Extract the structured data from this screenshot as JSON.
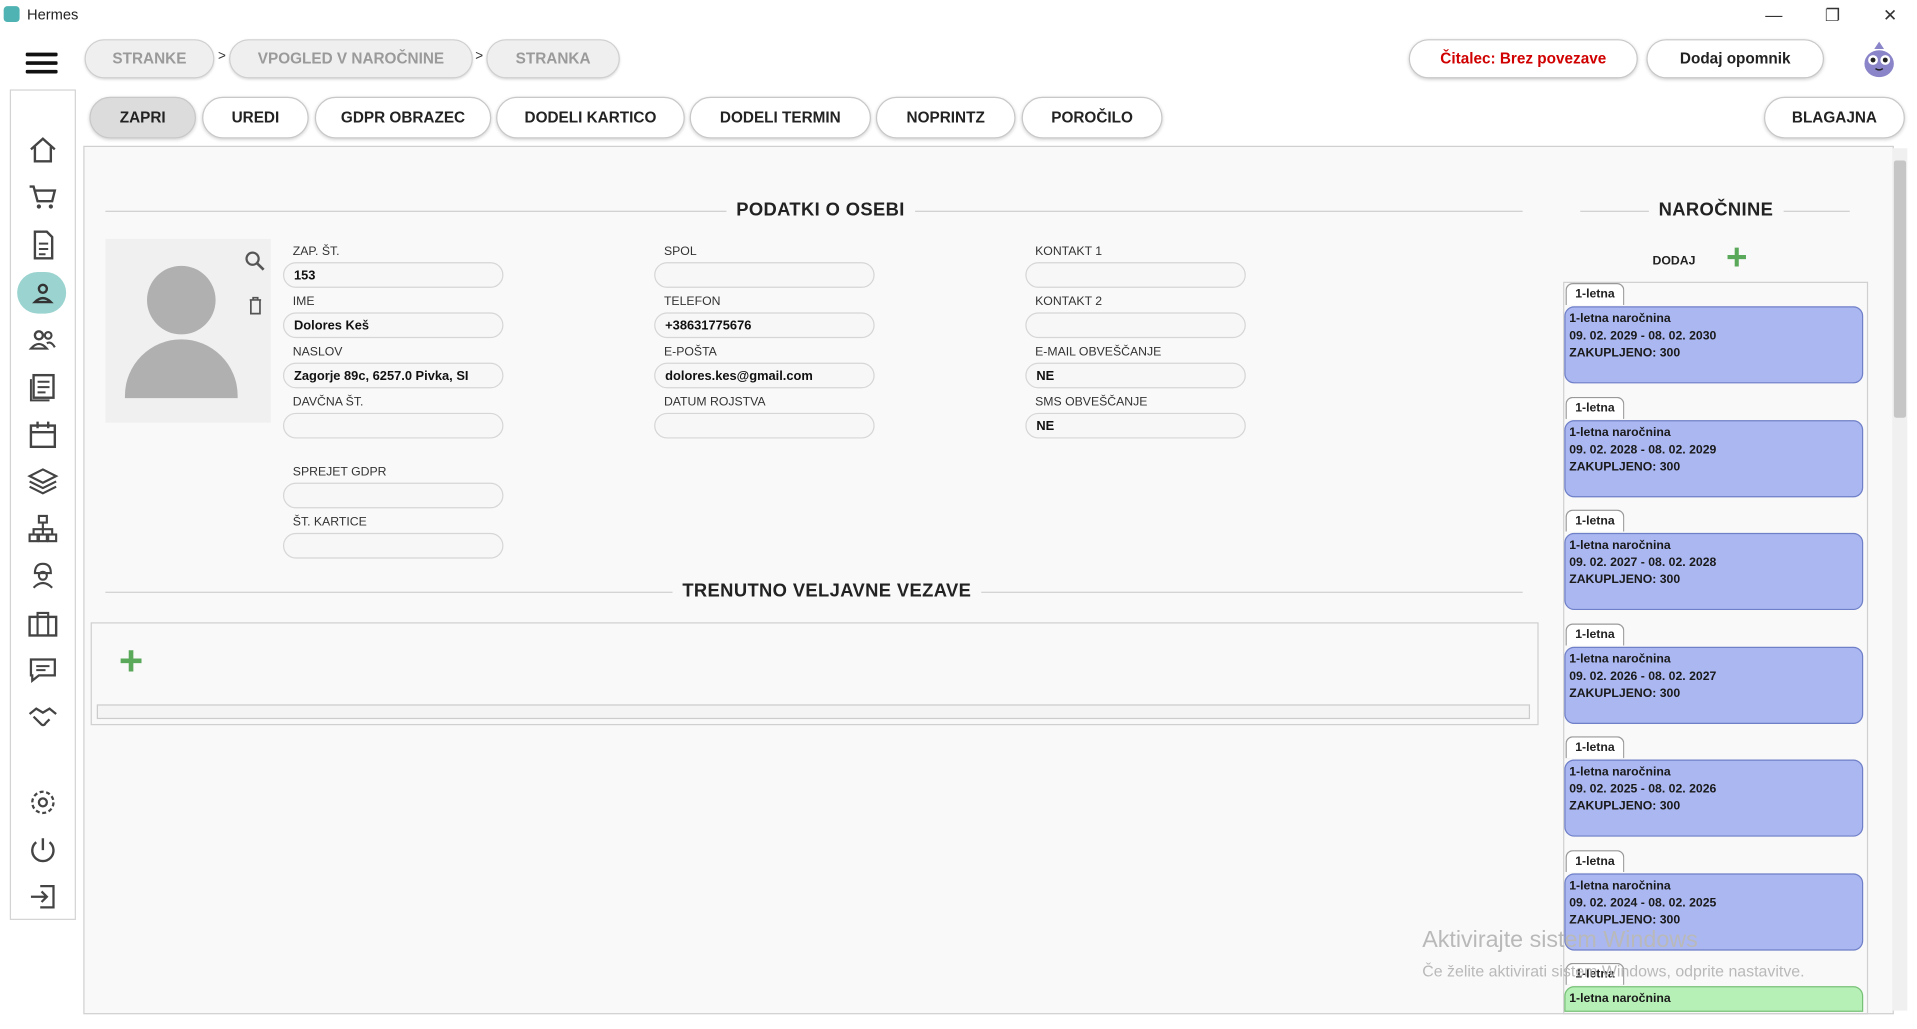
{
  "window": {
    "title": "Hermes",
    "controls": [
      "—",
      "❐",
      "✕"
    ]
  },
  "breadcrumb": [
    "STRANKE",
    "VPOGLED V NAROČNINE",
    "STRANKA"
  ],
  "breadcrumb_sep": ">",
  "top_right": {
    "reader_status": "Čitalec: Brez povezave",
    "add_reminder": "Dodaj opomnik"
  },
  "toolbar": [
    "ZAPRI",
    "UREDI",
    "GDPR OBRAZEC",
    "DODELI KARTICO",
    "DODELI TERMIN",
    "NOPRINTZ",
    "POROČILO"
  ],
  "cashier_button": "BLAGAJNA",
  "person": {
    "section_title": "PODATKI O OSEBI",
    "fields": {
      "zap_st": {
        "label": "ZAP. ŠT.",
        "value": "153"
      },
      "ime": {
        "label": "IME",
        "value": "Dolores Keš"
      },
      "naslov": {
        "label": "NASLOV",
        "value": "Zagorje 89c, 6257.0 Pivka, SI"
      },
      "davcna": {
        "label": "DAVČNA ŠT.",
        "value": ""
      },
      "gdpr": {
        "label": "SPREJET GDPR",
        "value": ""
      },
      "kartica": {
        "label": "ŠT. KARTICE",
        "value": ""
      },
      "spol": {
        "label": "SPOL",
        "value": ""
      },
      "telefon": {
        "label": "TELEFON",
        "value": "+38631775676"
      },
      "eposta": {
        "label": "E-POŠTA",
        "value": "dolores.kes@gmail.com"
      },
      "rojstvo": {
        "label": "DATUM ROJSTVA",
        "value": ""
      },
      "kontakt1": {
        "label": "KONTAKT 1",
        "value": ""
      },
      "kontakt2": {
        "label": "KONTAKT 2",
        "value": ""
      },
      "email_obv": {
        "label": "E-MAIL OBVEŠČANJE",
        "value": "NE"
      },
      "sms_obv": {
        "label": "SMS OBVEŠČANJE",
        "value": "NE"
      }
    }
  },
  "links": {
    "section_title": "TRENUTNO VELJAVNE VEZAVE"
  },
  "subscriptions": {
    "title": "NAROČNINE",
    "add_label": "DODAJ",
    "items": [
      {
        "tab": "1-letna",
        "name": "1-letna naročnina",
        "period": "09. 02. 2029 - 08. 02. 2030",
        "purchased": "ZAKUPLJENO: 300"
      },
      {
        "tab": "1-letna",
        "name": "1-letna naročnina",
        "period": "09. 02. 2028 - 08. 02. 2029",
        "purchased": "ZAKUPLJENO: 300"
      },
      {
        "tab": "1-letna",
        "name": "1-letna naročnina",
        "period": "09. 02. 2027 - 08. 02. 2028",
        "purchased": "ZAKUPLJENO: 300"
      },
      {
        "tab": "1-letna",
        "name": "1-letna naročnina",
        "period": "09. 02. 2026 - 08. 02. 2027",
        "purchased": "ZAKUPLJENO: 300"
      },
      {
        "tab": "1-letna",
        "name": "1-letna naročnina",
        "period": "09. 02. 2025 - 08. 02. 2026",
        "purchased": "ZAKUPLJENO: 300"
      },
      {
        "tab": "1-letna",
        "name": "1-letna naročnina",
        "period": "09. 02. 2024 - 08. 02. 2025",
        "purchased": "ZAKUPLJENO: 300"
      },
      {
        "tab": "1-letna",
        "name": "1-letna naročnina",
        "period": "",
        "purchased": ""
      }
    ]
  },
  "watermark": {
    "line1": "Aktivirajte sistem Windows",
    "line2": "Če želite aktivirati sistem Windows, odprite nastavitve."
  },
  "colors": {
    "active_sidebar": "#9ad3cf",
    "subscription_card": "#aab7f1",
    "subscription_card_current": "#b6f0b6",
    "reader_status": "#d00000",
    "plus": "#5aa85a"
  }
}
